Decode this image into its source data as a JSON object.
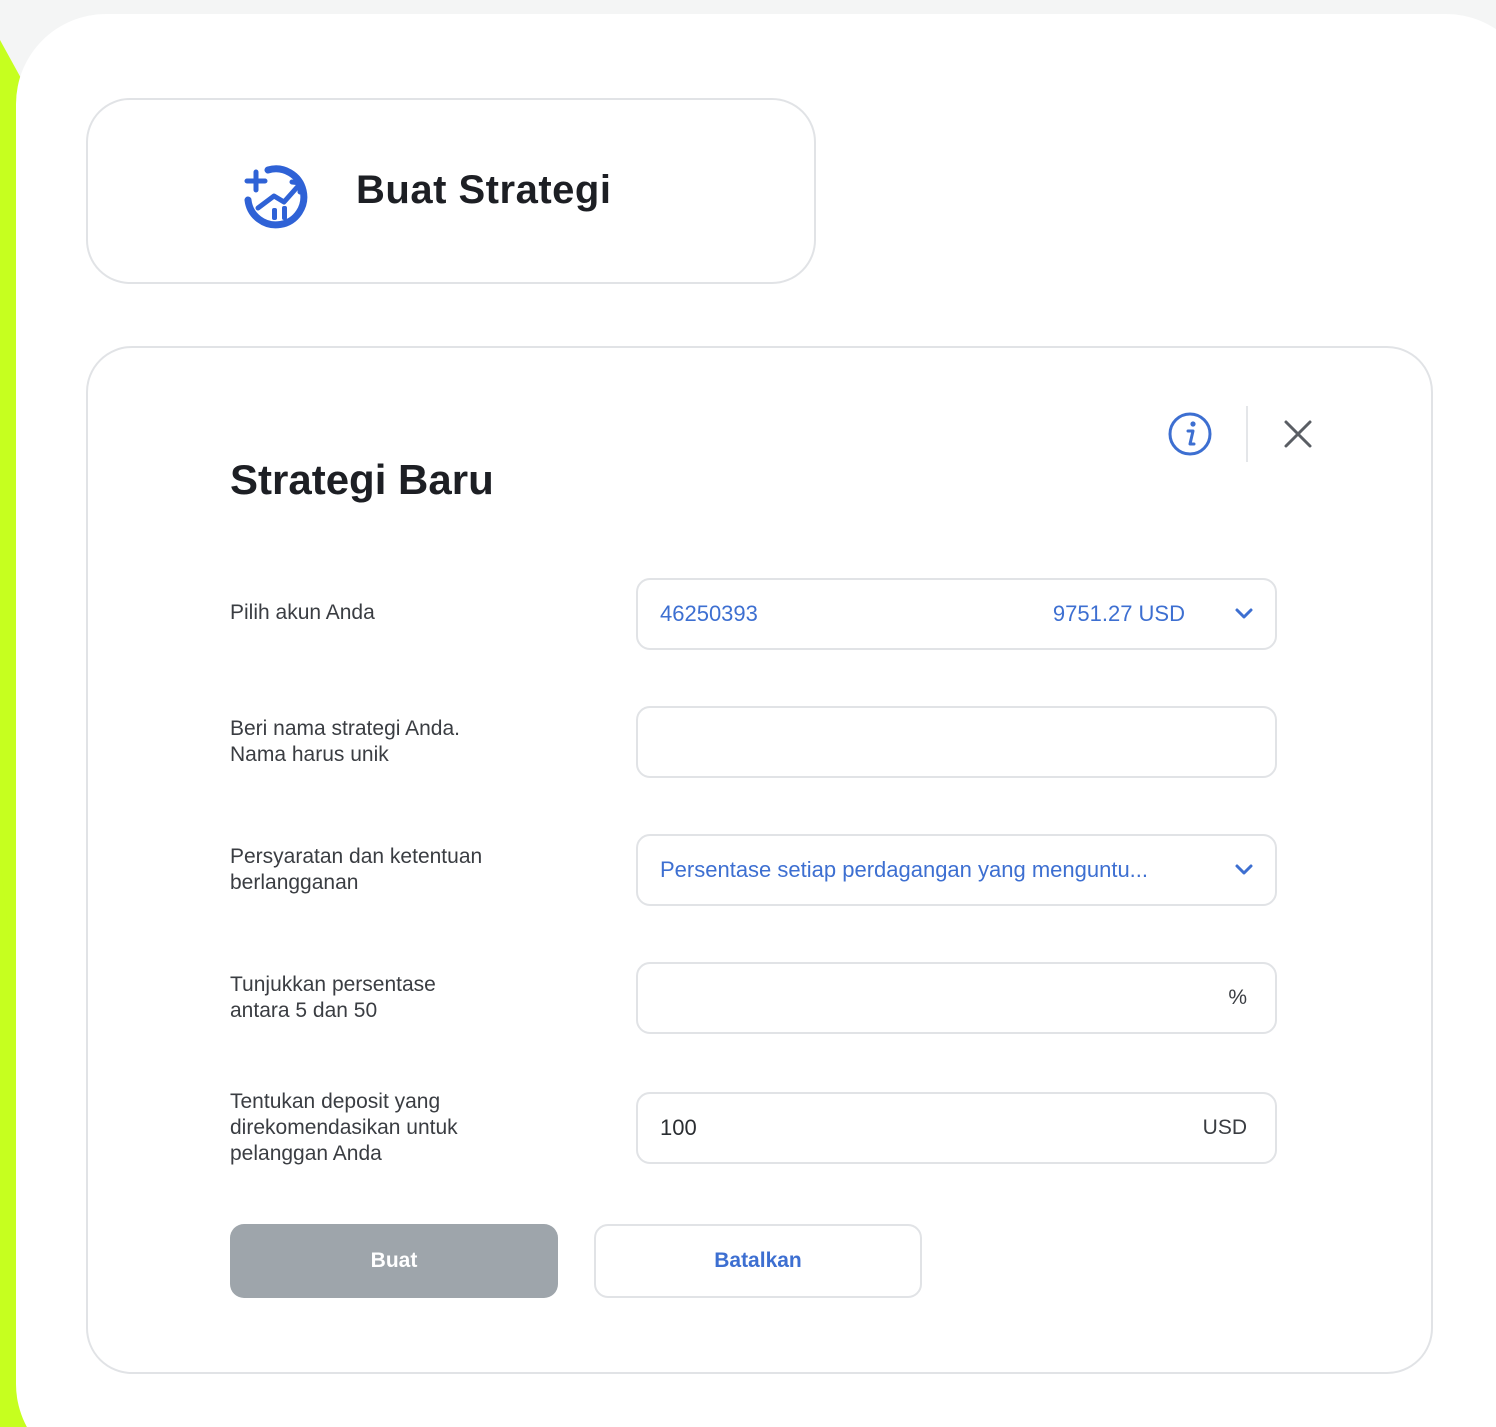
{
  "header": {
    "title": "Buat Strategi",
    "icon": "add-strategy-chart-icon"
  },
  "form": {
    "title": "Strategi Baru",
    "info_icon": "info-icon",
    "close_icon": "close-icon",
    "rows": [
      {
        "label_lines": [
          "Pilih akun Anda"
        ],
        "type": "select",
        "value": "46250393",
        "secondary": "9751.27 USD"
      },
      {
        "label_lines": [
          "Beri nama strategi Anda.",
          "Nama harus unik"
        ],
        "type": "text",
        "value": ""
      },
      {
        "label_lines": [
          "Persyaratan dan ketentuan",
          "berlangganan"
        ],
        "type": "select",
        "value": "Persentase setiap perdagangan yang menguntu..."
      },
      {
        "label_lines": [
          "Tunjukkan persentase",
          "antara 5 dan 50"
        ],
        "type": "text",
        "value": "",
        "suffix": "%"
      },
      {
        "label_lines": [
          "Tentukan deposit yang",
          "direkomendasikan untuk",
          "pelanggan Anda"
        ],
        "type": "text",
        "value": "100",
        "suffix": "USD"
      }
    ],
    "buttons": {
      "create": "Buat",
      "cancel": "Batalkan"
    }
  },
  "colors": {
    "accent_blue": "#3d6fd1",
    "lime": "#c6ff1f",
    "button_disabled": "#9ea5ab"
  }
}
